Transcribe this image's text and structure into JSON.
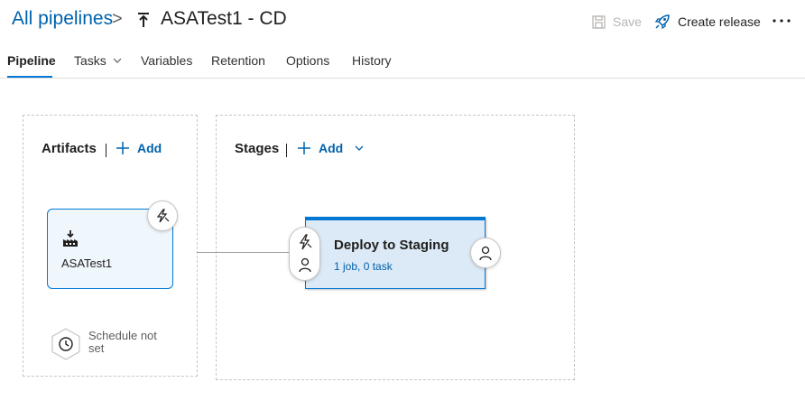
{
  "breadcrumb": {
    "parent": "All pipelines",
    "separator": ">"
  },
  "page_title": "ASATest1 - CD",
  "toolbar": {
    "save_label": "Save",
    "create_release_label": "Create release",
    "more_icon": "more-icon"
  },
  "tabs": [
    {
      "label": "Pipeline",
      "active": true
    },
    {
      "label": "Tasks",
      "has_dropdown": true
    },
    {
      "label": "Variables"
    },
    {
      "label": "Retention"
    },
    {
      "label": "Options"
    },
    {
      "label": "History"
    }
  ],
  "artifacts": {
    "title": "Artifacts",
    "add_label": "Add",
    "items": [
      {
        "name": "ASATest1",
        "icon": "build-artifact-icon"
      }
    ],
    "schedule_label": "Schedule not set"
  },
  "stages": {
    "title": "Stages",
    "add_label": "Add",
    "items": [
      {
        "name": "Deploy to Staging",
        "summary": "1 job, 0 task"
      }
    ]
  },
  "colors": {
    "accent": "#0078d4",
    "link": "#0062ad",
    "stage_bg": "#dce9f6",
    "artifact_bg": "#eff6fc"
  }
}
